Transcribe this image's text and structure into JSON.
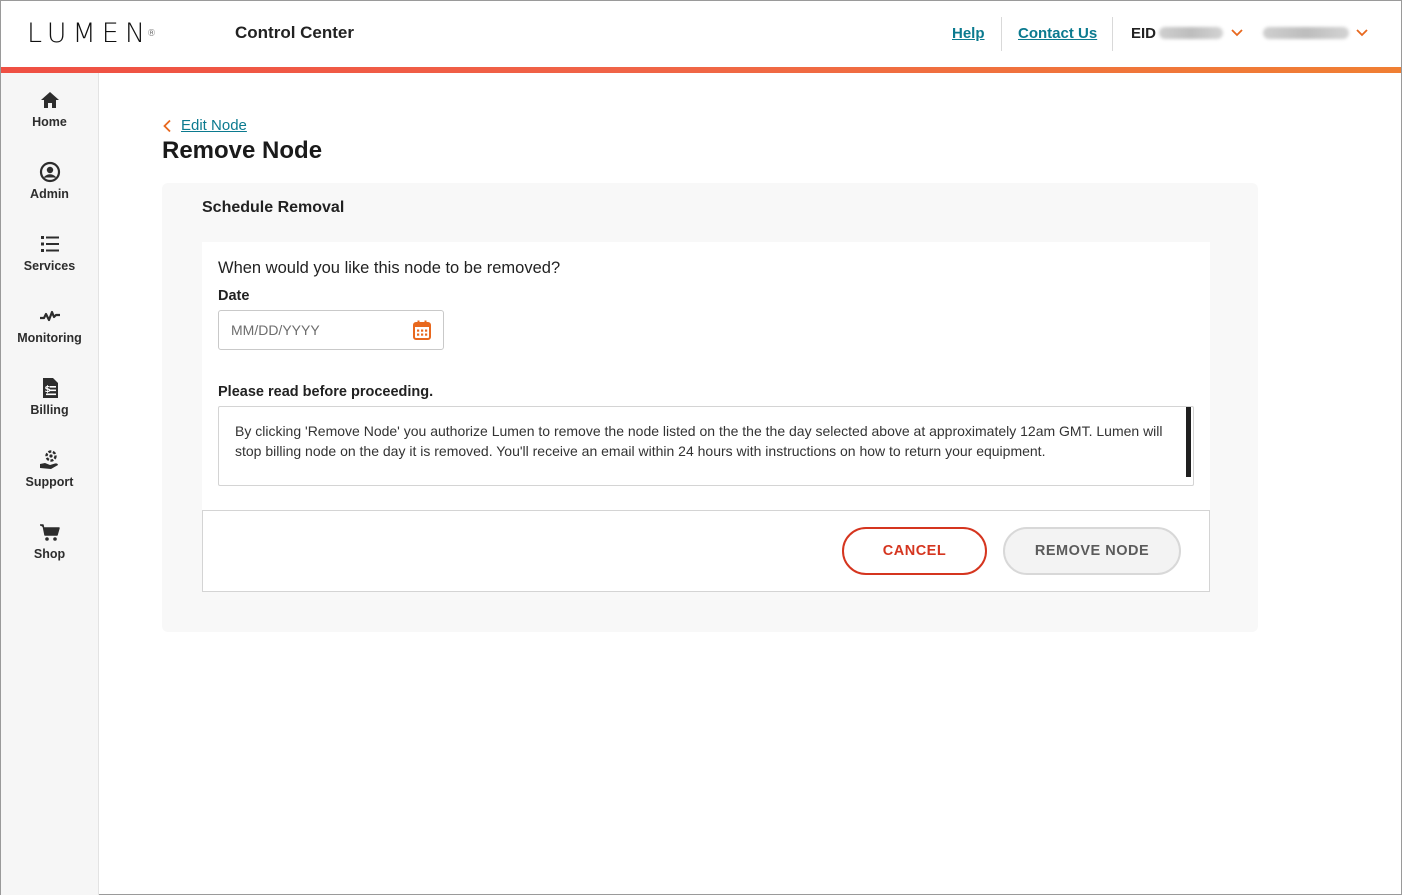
{
  "header": {
    "logo_text": "LUMEN",
    "logo_mark": "®",
    "app_title": "Control Center",
    "help_label": "Help",
    "contact_label": "Contact Us",
    "eid_label": "EID"
  },
  "sidebar": {
    "items": [
      {
        "label": "Home",
        "icon": "home-icon"
      },
      {
        "label": "Admin",
        "icon": "user-icon"
      },
      {
        "label": "Services",
        "icon": "list-icon"
      },
      {
        "label": "Monitoring",
        "icon": "pulse-icon"
      },
      {
        "label": "Billing",
        "icon": "bill-icon"
      },
      {
        "label": "Support",
        "icon": "support-icon"
      },
      {
        "label": "Shop",
        "icon": "cart-icon"
      }
    ]
  },
  "main": {
    "back_label": "Edit Node",
    "page_title": "Remove Node",
    "card_title": "Schedule Removal",
    "question": "When would you like this node to be removed?",
    "date_label": "Date",
    "date_placeholder": "MM/DD/YYYY",
    "date_value": "",
    "read_label": "Please read before proceeding.",
    "terms_text": "By clicking 'Remove Node' you authorize Lumen to remove the node listed on the the the day selected above at approximately 12am GMT. Lumen will stop billing node on the day it is removed. You'll receive an email within 24 hours with instructions on how to return your equipment.",
    "cancel_label": "CANCEL",
    "remove_label": "REMOVE NODE"
  },
  "colors": {
    "accent_teal": "#0b7a8f",
    "accent_orange": "#e8681e",
    "cancel_red": "#d5351f",
    "bar_start": "#ef4f43",
    "bar_end": "#f07f33"
  }
}
